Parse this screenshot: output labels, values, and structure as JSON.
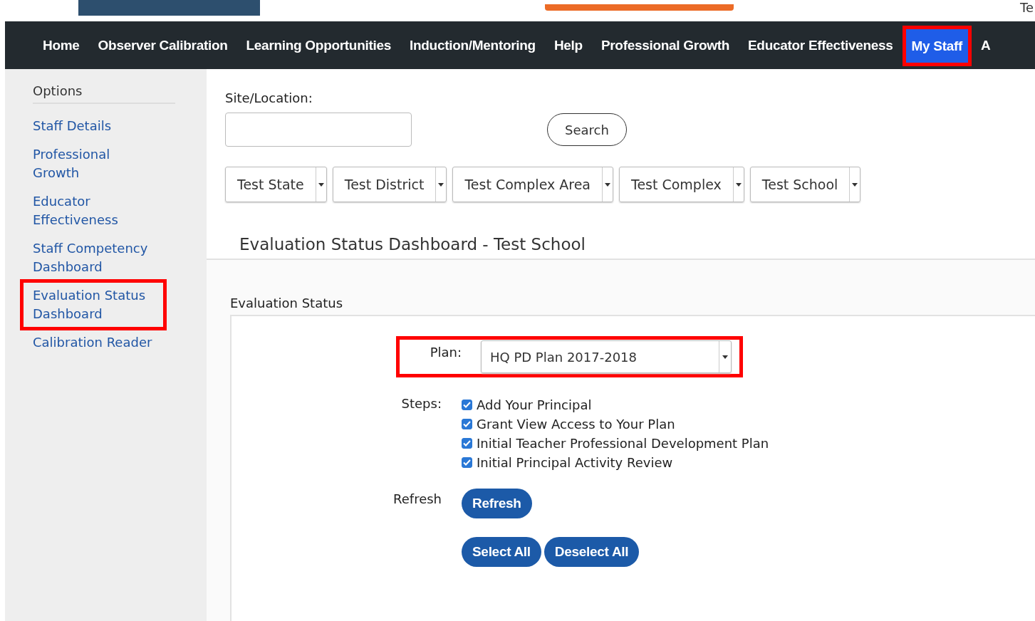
{
  "top_strip": {
    "corner_text": "Te"
  },
  "nav": {
    "items": [
      {
        "label": "Home",
        "selected": false,
        "highlighted": false
      },
      {
        "label": "Observer Calibration",
        "selected": false,
        "highlighted": false
      },
      {
        "label": "Learning Opportunities",
        "selected": false,
        "highlighted": false
      },
      {
        "label": "Induction/Mentoring",
        "selected": false,
        "highlighted": false
      },
      {
        "label": "Help",
        "selected": false,
        "highlighted": false
      },
      {
        "label": "Professional Growth",
        "selected": false,
        "highlighted": false
      },
      {
        "label": "Educator Effectiveness",
        "selected": false,
        "highlighted": false
      },
      {
        "label": "My Staff",
        "selected": true,
        "highlighted": true
      },
      {
        "label": "A",
        "selected": false,
        "highlighted": false
      }
    ]
  },
  "sidebar": {
    "title": "Options",
    "items": [
      {
        "label": "Staff Details",
        "highlighted": false
      },
      {
        "label": "Professional Growth",
        "highlighted": false
      },
      {
        "label": "Educator Effectiveness",
        "highlighted": false
      },
      {
        "label": "Staff Competency Dashboard",
        "highlighted": false
      },
      {
        "label": "Evaluation Status Dashboard",
        "highlighted": true
      },
      {
        "label": "Calibration Reader",
        "highlighted": false
      }
    ]
  },
  "filters": {
    "site_label": "Site/Location:",
    "search_button": "Search",
    "dropdowns": [
      "Test State",
      "Test District",
      "Test Complex Area",
      "Test Complex",
      "Test School"
    ]
  },
  "heading": "Evaluation Status Dashboard - Test School",
  "evaluation_status": {
    "title": "Evaluation Status",
    "plan": {
      "label": "Plan:",
      "value": "HQ PD Plan 2017-2018",
      "highlighted": true
    },
    "steps_label": "Steps:",
    "steps": [
      {
        "label": "Add Your Principal",
        "checked": true
      },
      {
        "label": "Grant View Access to Your Plan",
        "checked": true
      },
      {
        "label": "Initial Teacher Professional Development Plan",
        "checked": true
      },
      {
        "label": "Initial Principal Activity Review",
        "checked": true
      }
    ],
    "refresh_label": "Refresh",
    "refresh_button": "Refresh",
    "select_all_button": "Select All",
    "deselect_all_button": "Deselect All"
  }
}
